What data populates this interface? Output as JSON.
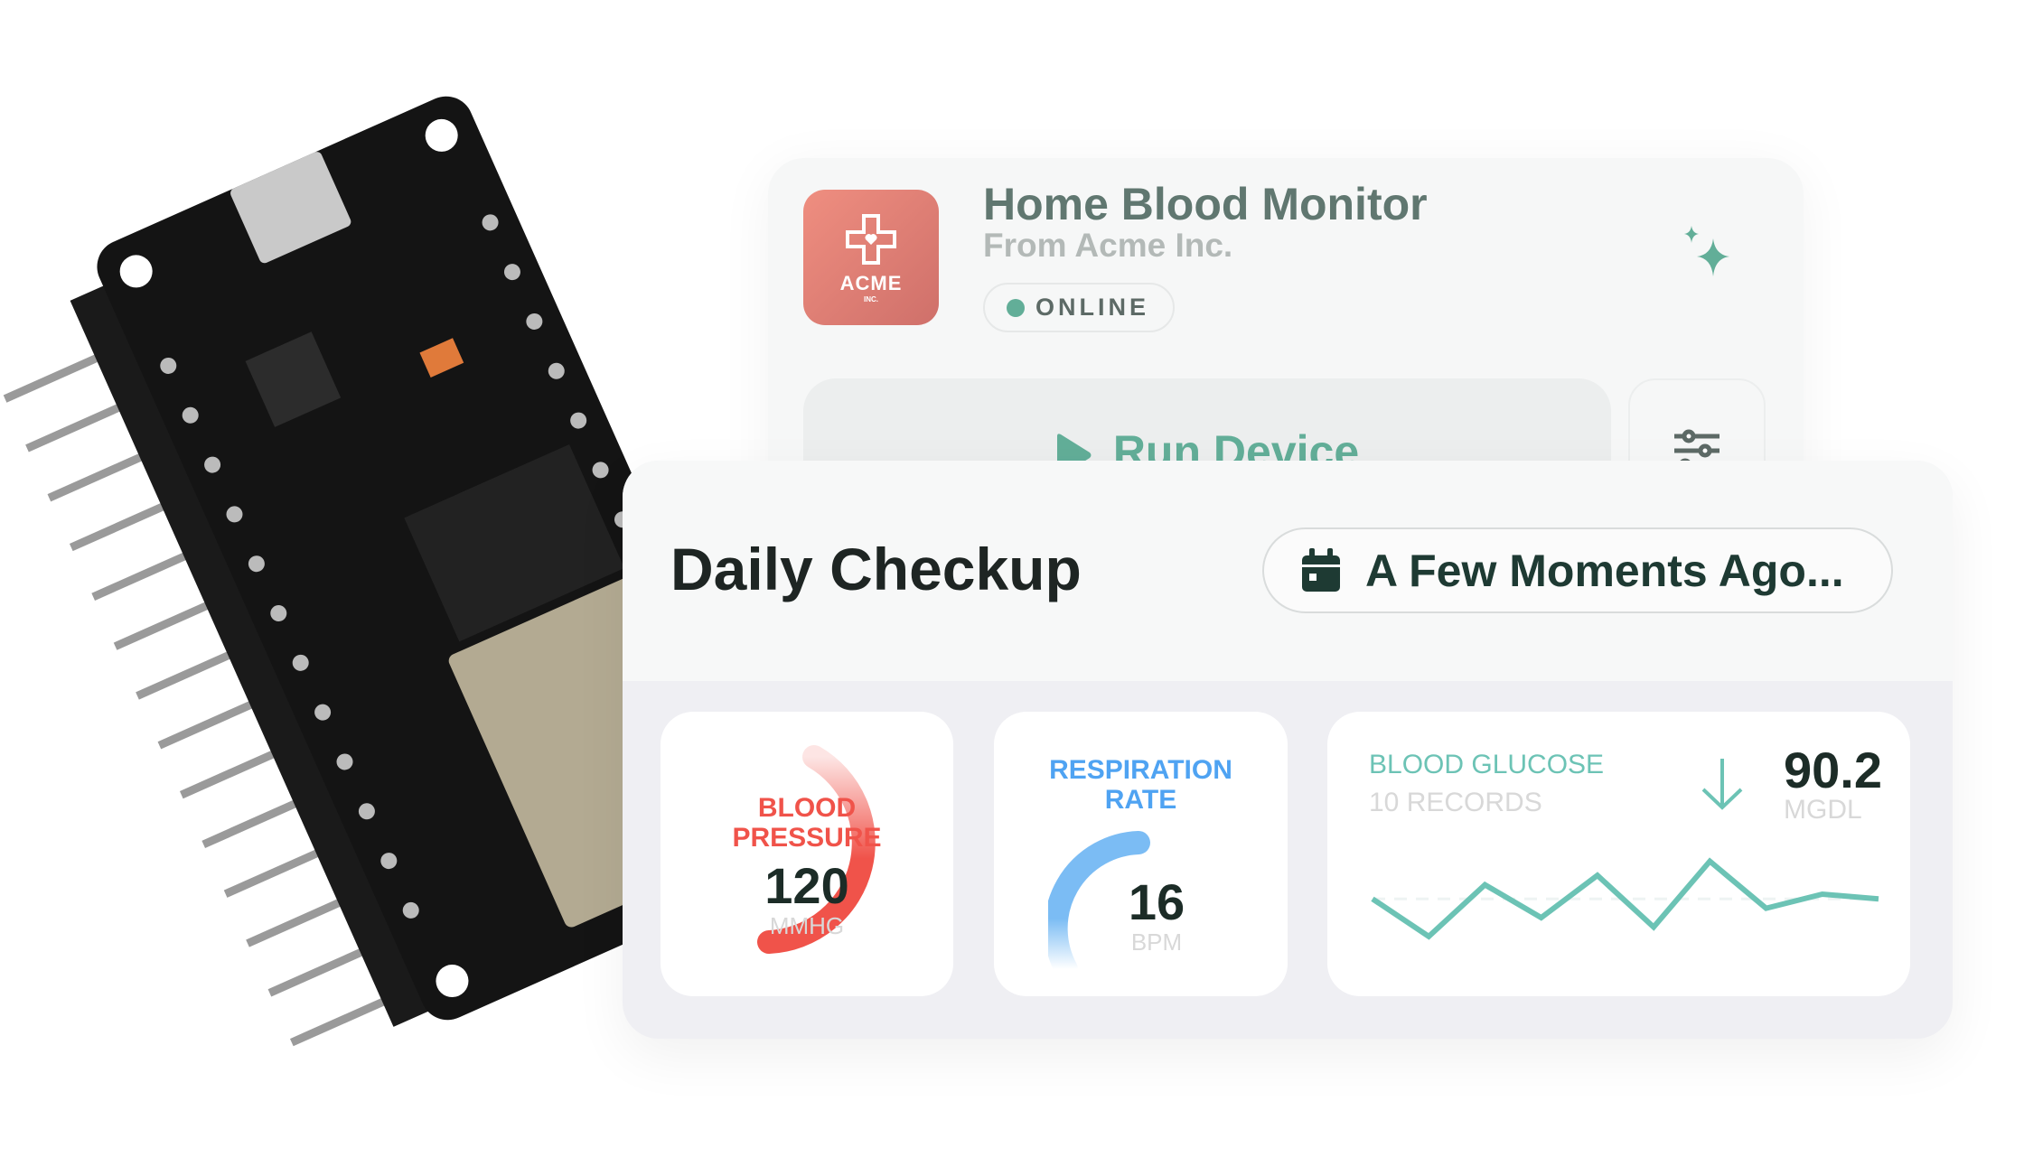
{
  "device": {
    "title": "Home Blood Monitor",
    "subtitle": "From Acme Inc.",
    "status": "ONLINE",
    "logo_text": "ACME",
    "logo_sub": "INC.",
    "run_label": "Run Device",
    "icons": [
      "sparkle-icon",
      "play-icon",
      "sliders-icon"
    ]
  },
  "checkup": {
    "title": "Daily Checkup",
    "time_label": "A Few Moments Ago...",
    "icon": "calendar-icon"
  },
  "metrics": {
    "bp": {
      "label1": "BLOOD",
      "label2": "PRESSURE",
      "value": "120",
      "unit": "MMHG",
      "color": "#f0534a"
    },
    "resp": {
      "label1": "RESPIRATION",
      "label2": "RATE",
      "value": "16",
      "unit": "BPM",
      "color": "#4fa3f2"
    },
    "glucose": {
      "label": "BLOOD GLUCOSE",
      "records": "10 RECORDS",
      "value": "90.2",
      "unit": "MGDL",
      "trend": "down",
      "color": "#6cc3b5"
    }
  },
  "chart_data": {
    "type": "line",
    "title": "BLOOD GLUCOSE",
    "x": [
      1,
      2,
      3,
      4,
      5,
      6,
      7,
      8,
      9,
      10
    ],
    "values": [
      89,
      81,
      92,
      85,
      94,
      83,
      97,
      87,
      90,
      89
    ],
    "ylim": [
      75,
      100
    ]
  }
}
